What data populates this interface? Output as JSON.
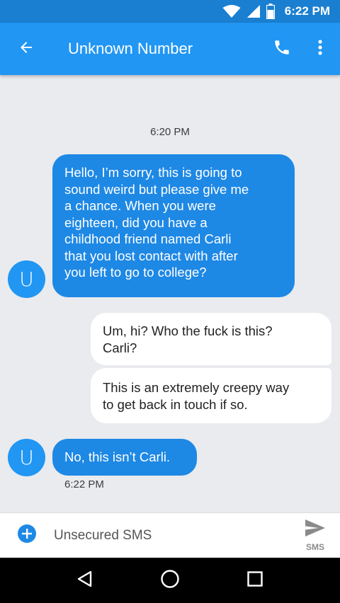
{
  "status_bar": {
    "time": "6:22 PM",
    "icons": [
      "wifi-icon",
      "cell-signal-icon",
      "battery-icon"
    ]
  },
  "app_bar": {
    "title": "Unknown Number",
    "back_icon": "arrow-back-icon",
    "call_icon": "phone-icon",
    "more_icon": "more-vert-icon"
  },
  "conversation": {
    "date_divider": "6:20 PM",
    "avatar_letter": "U",
    "messages": [
      {
        "direction": "incoming",
        "lines": [
          "Hello, I’m sorry, this is going to",
          "sound weird but please give me",
          "a chance. When you were",
          "eighteen, did you have a",
          "childhood friend named Carli",
          "that you lost contact with after",
          "you left to go to college?"
        ]
      },
      {
        "direction": "outgoing",
        "lines": [
          "Um, hi? Who the fuck is this?",
          "Carli?"
        ]
      },
      {
        "direction": "outgoing",
        "lines": [
          "This is an extremely creepy way",
          "to get back in touch if so."
        ]
      },
      {
        "direction": "incoming",
        "lines": [
          "No, this isn’t Carli."
        ],
        "time": "6:22 PM"
      }
    ]
  },
  "compose": {
    "placeholder": "Unsecured SMS",
    "send_label": "SMS",
    "attach_icon": "add-circle-icon",
    "send_icon": "send-icon"
  },
  "nav_bar": {
    "icons": [
      "back-triangle-icon",
      "home-circle-icon",
      "recents-square-icon"
    ]
  },
  "colors": {
    "primary": "#2196f3",
    "status_bar": "#1a7fd1",
    "incoming_bubble": "#1e88e5",
    "outgoing_bubble": "#ffffff",
    "background": "#e9ebef"
  }
}
